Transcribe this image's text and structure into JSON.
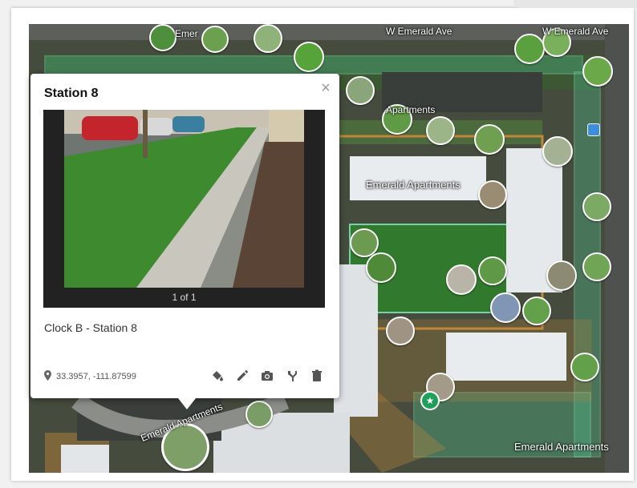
{
  "map": {
    "street_labels": [
      "W Emerald Ave",
      "W Emerald Ave",
      "Emer"
    ],
    "area_labels": [
      "Apartments",
      "Emerald Apartments",
      "Emerald Apartments",
      "Emerald Apartments"
    ]
  },
  "popup": {
    "title": "Station 8",
    "close_glyph": "×",
    "pager": "1 of 1",
    "caption": "Clock B - Station 8",
    "coordinates": "33.3957, -111.87599"
  },
  "icons": {
    "location": "map-pin-icon",
    "actions": [
      "paint-bucket-icon",
      "pencil-icon",
      "camera-icon",
      "branch-icon",
      "trash-icon"
    ],
    "bus": "bus-stop-icon",
    "star": "star-marker-icon"
  },
  "colors": {
    "overlay_green": "#4fbf8f",
    "overlay_orange": "#c0863a",
    "grass": "#2f7f2c",
    "pin_red": "#d4283a"
  }
}
